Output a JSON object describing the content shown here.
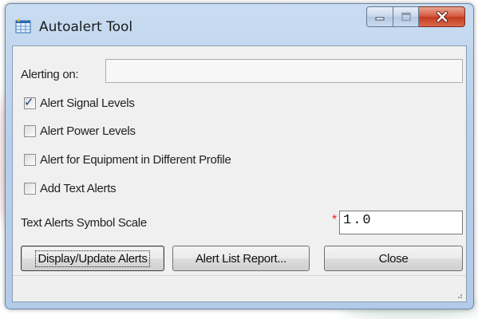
{
  "window": {
    "title": "Autoalert Tool",
    "icon": "app-grid-icon",
    "caption_buttons": [
      "minimize-icon",
      "maximize-icon",
      "close-icon"
    ]
  },
  "alerting": {
    "label": "Alerting on:",
    "value": ""
  },
  "options": [
    {
      "label": "Alert Signal Levels",
      "checked": true
    },
    {
      "label": "Alert Power Levels",
      "checked": false
    },
    {
      "label": "Alert for Equipment in Different Profile",
      "checked": false
    },
    {
      "label": "Add Text Alerts",
      "checked": false
    }
  ],
  "scale": {
    "label": "Text Alerts Symbol Scale",
    "required_marker": "*",
    "value": "1.0"
  },
  "buttons": {
    "display_update": "Display/Update Alerts",
    "report": "Alert List Report...",
    "close": "Close"
  },
  "colors": {
    "titlebar": "#b7cfeb",
    "close_button": "#c33b21",
    "required": "#e02020"
  }
}
